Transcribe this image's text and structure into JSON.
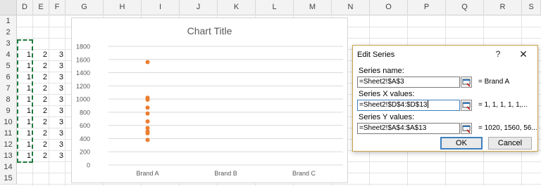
{
  "sheet": {
    "columns": [
      "D",
      "E",
      "F",
      "G",
      "H",
      "I",
      "J",
      "K",
      "L",
      "M",
      "N",
      "O",
      "P",
      "Q",
      "R",
      "S"
    ],
    "rows": [
      "1",
      "2",
      "3",
      "4",
      "5",
      "6",
      "7",
      "8",
      "9",
      "10",
      "11",
      "12",
      "13",
      "14",
      "15"
    ],
    "data_rows": [
      [
        "1",
        "2",
        "3"
      ],
      [
        "1",
        "2",
        "3"
      ],
      [
        "1",
        "2",
        "3"
      ],
      [
        "1",
        "2",
        "3"
      ],
      [
        "1",
        "2",
        "3"
      ],
      [
        "1",
        "2",
        "3"
      ],
      [
        "1",
        "2",
        "3"
      ],
      [
        "1",
        "2",
        "3"
      ],
      [
        "1",
        "2",
        "3"
      ],
      [
        "1",
        "2",
        "3"
      ]
    ]
  },
  "chart_data": {
    "type": "scatter",
    "title": "Chart Title",
    "categories": [
      "Brand A",
      "Brand B",
      "Brand C"
    ],
    "ylim": [
      0,
      1800
    ],
    "yticks": [
      "0",
      "200",
      "400",
      "600",
      "800",
      "1000",
      "1200",
      "1400",
      "1600",
      "1800"
    ],
    "series": [
      {
        "x": [
          1,
          1,
          1,
          1,
          1,
          1,
          1,
          1,
          1,
          1
        ],
        "y": [
          1020,
          1560,
          560,
          380,
          480,
          510,
          660,
          870,
          780,
          990
        ]
      }
    ],
    "colors": {
      "marker": "#ed7d31",
      "grid": "#d9d9d9",
      "axis_text": "#595959"
    },
    "grid": true
  },
  "dialog": {
    "title": "Edit Series",
    "help": "?",
    "close": "✕",
    "name_label": "Series name:",
    "name_value": "=Sheet2!$A$3",
    "name_result": "= Brand A",
    "x_label": "Series X values:",
    "x_value": "=Sheet2!$D$4:$D$13",
    "x_result": "= 1, 1, 1, 1, 1,...",
    "y_label": "Series Y values:",
    "y_value": "=Sheet2!$A$4:$A$13",
    "y_result": "= 1020, 1560, 56...",
    "ok": "OK",
    "cancel": "Cancel",
    "range_icon": "collapse-range-icon"
  }
}
